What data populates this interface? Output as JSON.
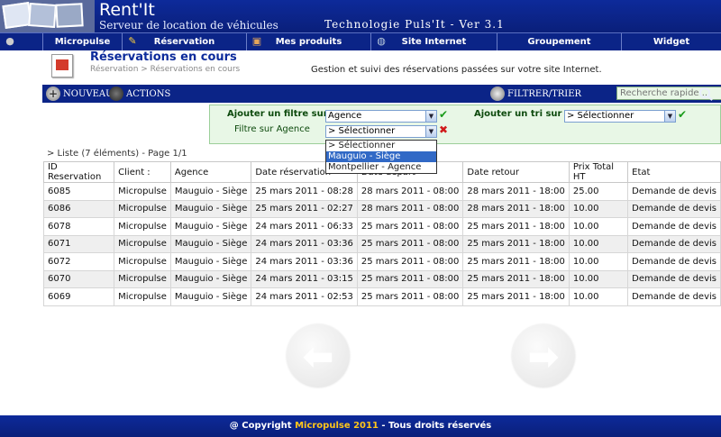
{
  "header": {
    "brand": "Rent'It",
    "tagline": "Serveur de location de véhicules",
    "tech": "Technologie Puls'It - Ver 3.1"
  },
  "menu": [
    {
      "label": "Micropulse",
      "icon": "globe-icon"
    },
    {
      "label": "Réservation",
      "icon": "calendar-icon"
    },
    {
      "label": "Mes produits",
      "icon": "box-icon"
    },
    {
      "label": "Site Internet",
      "icon": "world-icon"
    },
    {
      "label": "Groupement",
      "icon": ""
    },
    {
      "label": "Widget",
      "icon": ""
    }
  ],
  "page": {
    "title": "Réservations en cours",
    "breadcrumb": "Réservation > Réservations en cours",
    "subtitle": "Gestion et suivi des réservations passées sur votre site Internet."
  },
  "toolbar": {
    "new_label": "Nouveau",
    "actions_label": "Actions",
    "filter_label": "Filtrer/Trier",
    "search_placeholder": "Recherche rapide..."
  },
  "filters": {
    "add_filter_label": "Ajouter un filtre sur",
    "add_filter_value": "Agence",
    "add_sort_label": "Ajouter un tri sur",
    "add_sort_value": "> Sélectionner",
    "agency_filter_label": "Filtre sur Agence",
    "agency_filter_value": "> Sélectionner",
    "dropdown_options": [
      "> Sélectionner",
      "Mauguio - Siège",
      "Montpellier - Agence"
    ],
    "highlighted_option": 1
  },
  "list": {
    "count_label": "> Liste (7 éléments) - Page 1/1",
    "columns": [
      "ID Reservation",
      "Client :",
      "Agence",
      "Date réservation",
      "Date départ",
      "Date retour",
      "Prix Total HT",
      "Etat"
    ],
    "rows": [
      [
        "6085",
        "Micropulse",
        "Mauguio - Siège",
        "25 mars 2011 - 08:28",
        "28 mars 2011 - 08:00",
        "28 mars 2011 - 18:00",
        "25.00",
        "Demande de devis"
      ],
      [
        "6086",
        "Micropulse",
        "Mauguio - Siège",
        "25 mars 2011 - 02:27",
        "28 mars 2011 - 08:00",
        "28 mars 2011 - 18:00",
        "10.00",
        "Demande de devis"
      ],
      [
        "6078",
        "Micropulse",
        "Mauguio - Siège",
        "24 mars 2011 - 06:33",
        "25 mars 2011 - 08:00",
        "25 mars 2011 - 18:00",
        "10.00",
        "Demande de devis"
      ],
      [
        "6071",
        "Micropulse",
        "Mauguio - Siège",
        "24 mars 2011 - 03:36",
        "25 mars 2011 - 08:00",
        "25 mars 2011 - 18:00",
        "10.00",
        "Demande de devis"
      ],
      [
        "6072",
        "Micropulse",
        "Mauguio - Siège",
        "24 mars 2011 - 03:36",
        "25 mars 2011 - 08:00",
        "25 mars 2011 - 18:00",
        "10.00",
        "Demande de devis"
      ],
      [
        "6070",
        "Micropulse",
        "Mauguio - Siège",
        "24 mars 2011 - 03:15",
        "25 mars 2011 - 08:00",
        "25 mars 2011 - 18:00",
        "10.00",
        "Demande de devis"
      ],
      [
        "6069",
        "Micropulse",
        "Mauguio - Siège",
        "24 mars 2011 - 02:53",
        "25 mars 2011 - 08:00",
        "25 mars 2011 - 18:00",
        "10.00",
        "Demande de devis"
      ]
    ]
  },
  "footer": {
    "prefix": "@ Copyright",
    "accent": "Micropulse 2011",
    "suffix": "- Tous droits réservés"
  },
  "colors": {
    "brand_blue": "#0b2487",
    "filter_bg": "#e8f7e6",
    "accent_gold": "#ffc61a"
  }
}
